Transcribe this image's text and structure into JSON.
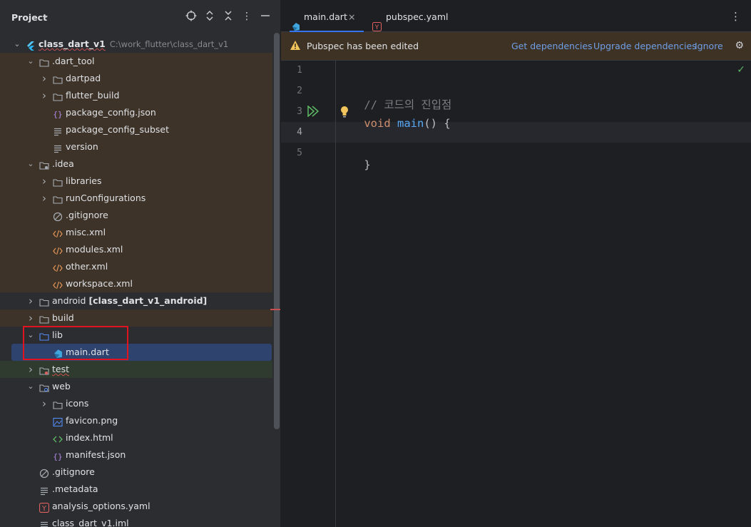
{
  "project_pane": {
    "title": "Project",
    "tree": [
      {
        "label": "class_dart_v1",
        "path": "C:\\work_flutter\\class_dart_v1",
        "icon": "flutter-icon",
        "indent": 0,
        "chevron": "open",
        "bold": true,
        "squiggle": true
      },
      {
        "label": ".dart_tool",
        "icon": "folder-icon",
        "indent": 1,
        "chevron": "open",
        "bg": "excluded"
      },
      {
        "label": "dartpad",
        "icon": "folder-icon",
        "indent": 2,
        "chevron": "closed",
        "bg": "excluded"
      },
      {
        "label": "flutter_build",
        "icon": "folder-icon",
        "indent": 2,
        "chevron": "closed",
        "bg": "excluded"
      },
      {
        "label": "package_config.json",
        "icon": "json-icon",
        "indent": 2,
        "chevron": "none",
        "bg": "excluded"
      },
      {
        "label": "package_config_subset",
        "icon": "text-file-icon",
        "indent": 2,
        "chevron": "none",
        "bg": "excluded"
      },
      {
        "label": "version",
        "icon": "text-file-icon",
        "indent": 2,
        "chevron": "none",
        "bg": "excluded"
      },
      {
        "label": ".idea",
        "icon": "idea-folder-icon",
        "indent": 1,
        "chevron": "open",
        "bg": "excluded"
      },
      {
        "label": "libraries",
        "icon": "folder-icon",
        "indent": 2,
        "chevron": "closed",
        "bg": "excluded"
      },
      {
        "label": "runConfigurations",
        "icon": "folder-icon",
        "indent": 2,
        "chevron": "closed",
        "bg": "excluded"
      },
      {
        "label": ".gitignore",
        "icon": "gitignore-icon",
        "indent": 2,
        "chevron": "none",
        "bg": "excluded"
      },
      {
        "label": "misc.xml",
        "icon": "xml-icon",
        "indent": 2,
        "chevron": "none",
        "bg": "excluded"
      },
      {
        "label": "modules.xml",
        "icon": "xml-icon",
        "indent": 2,
        "chevron": "none",
        "bg": "excluded"
      },
      {
        "label": "other.xml",
        "icon": "xml-icon",
        "indent": 2,
        "chevron": "none",
        "bg": "excluded"
      },
      {
        "label": "workspace.xml",
        "icon": "xml-icon",
        "indent": 2,
        "chevron": "none",
        "bg": "excluded"
      },
      {
        "label": "android",
        "suffix": "[class_dart_v1_android]",
        "icon": "folder-icon",
        "indent": 1,
        "chevron": "closed"
      },
      {
        "label": "build",
        "icon": "folder-icon",
        "indent": 1,
        "chevron": "closed",
        "bg": "excluded"
      },
      {
        "label": "lib",
        "icon": "source-folder-icon",
        "indent": 1,
        "chevron": "open"
      },
      {
        "label": "main.dart",
        "icon": "dart-file-icon",
        "indent": 2,
        "chevron": "none",
        "bg": "selected"
      },
      {
        "label": "test",
        "icon": "test-folder-icon",
        "indent": 1,
        "chevron": "closed",
        "bg": "test",
        "squiggle": true
      },
      {
        "label": "web",
        "icon": "web-folder-icon",
        "indent": 1,
        "chevron": "open"
      },
      {
        "label": "icons",
        "icon": "folder-icon",
        "indent": 2,
        "chevron": "closed"
      },
      {
        "label": "favicon.png",
        "icon": "image-file-icon",
        "indent": 2,
        "chevron": "none"
      },
      {
        "label": "index.html",
        "icon": "html-file-icon",
        "indent": 2,
        "chevron": "none"
      },
      {
        "label": "manifest.json",
        "icon": "json-icon",
        "indent": 2,
        "chevron": "none"
      },
      {
        "label": ".gitignore",
        "icon": "gitignore-icon",
        "indent": 1,
        "chevron": "none"
      },
      {
        "label": ".metadata",
        "icon": "text-file-icon",
        "indent": 1,
        "chevron": "none"
      },
      {
        "label": "analysis_options.yaml",
        "icon": "yaml-icon",
        "indent": 1,
        "chevron": "none"
      },
      {
        "label": "class_dart_v1.iml",
        "icon": "text-file-icon",
        "indent": 1,
        "chevron": "none"
      }
    ]
  },
  "editor": {
    "tabs": [
      {
        "label": "main.dart",
        "icon": "dart-file-icon",
        "active": true,
        "close": "×"
      },
      {
        "label": "pubspec.yaml",
        "icon": "yaml-icon",
        "active": false
      }
    ],
    "notice": {
      "text": "Pubspec has been edited",
      "links": [
        "Get dependencies",
        "Upgrade dependencies",
        "Ignore"
      ]
    },
    "line_numbers": [
      "1",
      "2",
      "3",
      "4",
      "5"
    ],
    "code": {
      "line2": "// 코드의 진입점",
      "line3_kw": "void",
      "line3_fn": "main",
      "line3_rest": "() {",
      "line5": "}"
    }
  },
  "colors": {
    "accent": "#3574f0",
    "selection": "#2e436e",
    "excluded_bg": "#3d3328",
    "highlight_box": "#e0141e",
    "link": "#6f9fe8"
  }
}
